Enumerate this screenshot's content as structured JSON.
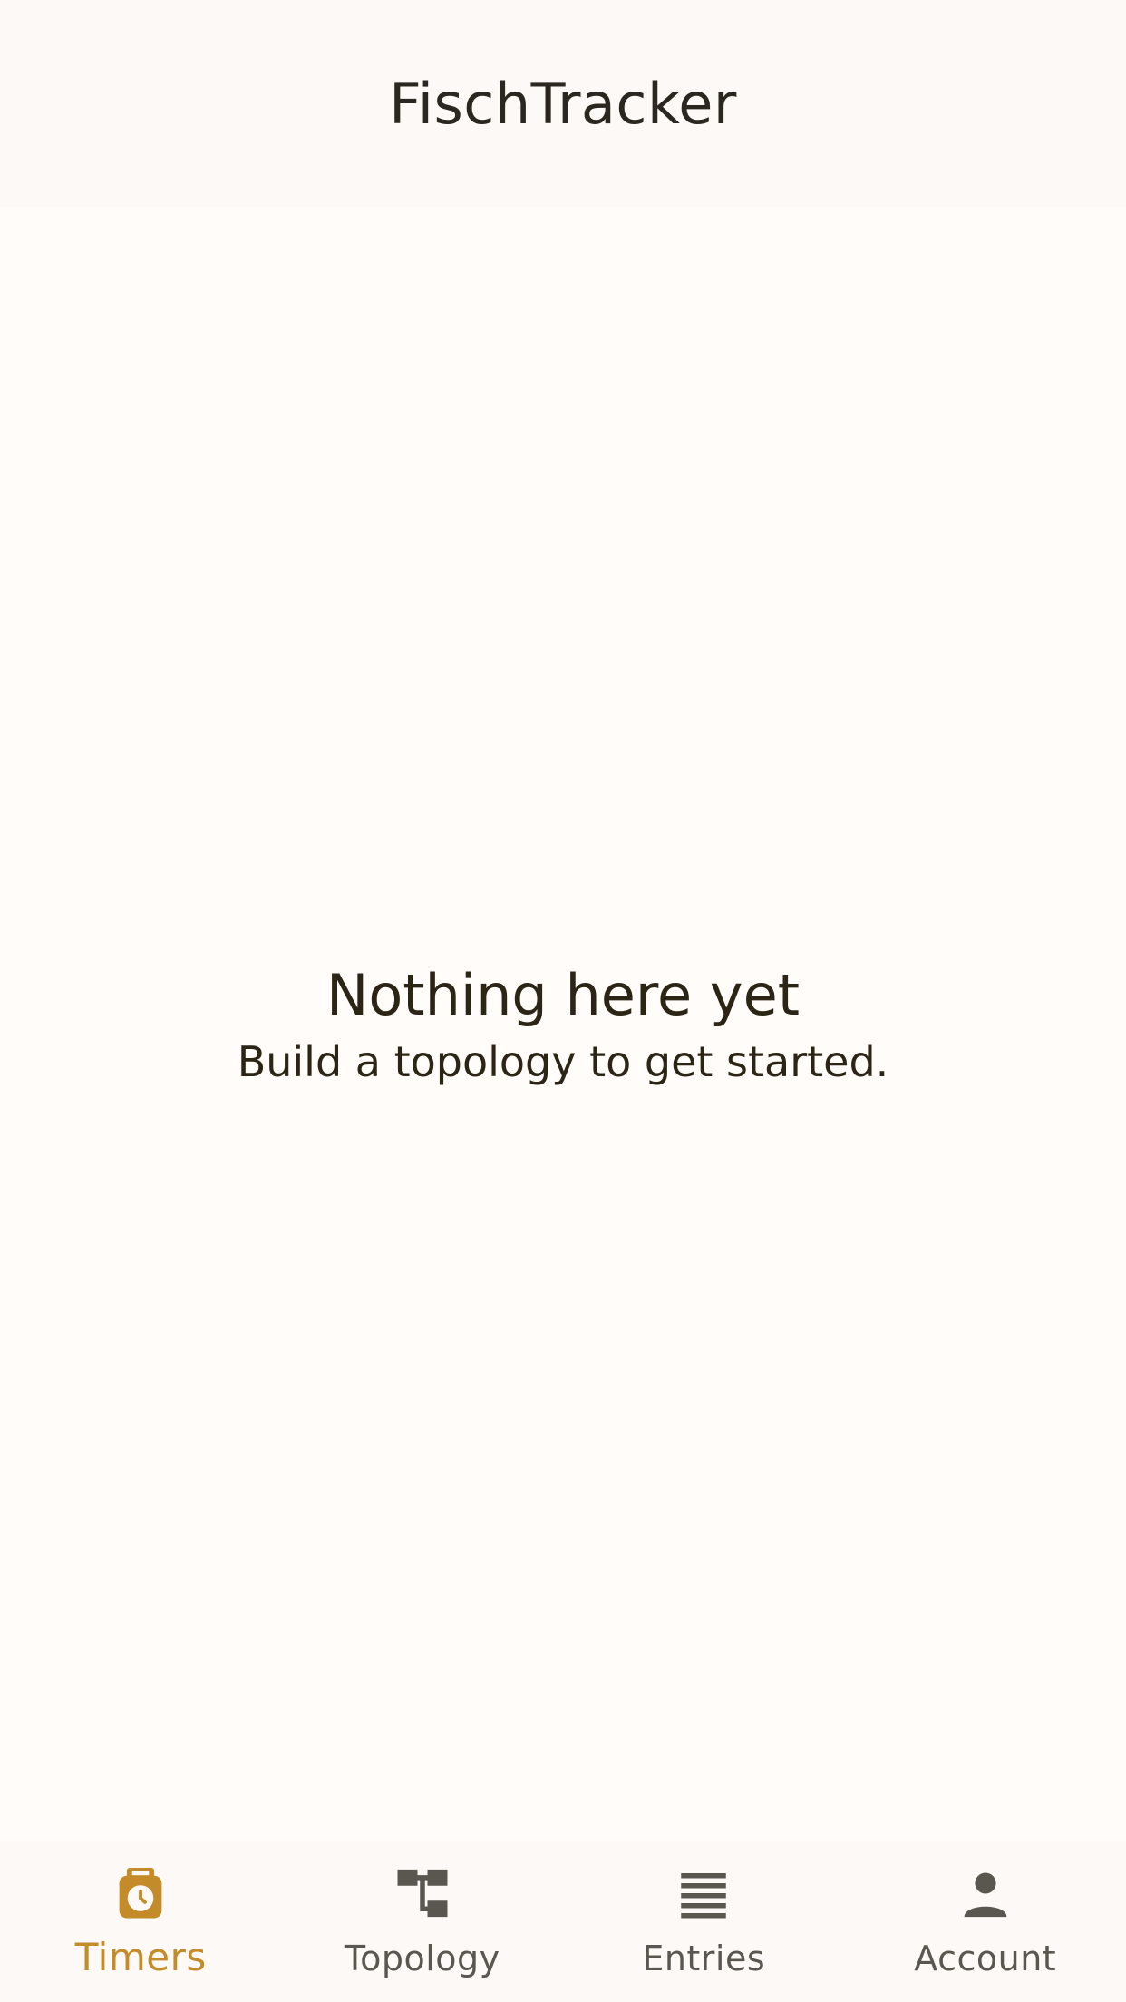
{
  "app": {
    "title": "FischTracker"
  },
  "empty_state": {
    "title": "Nothing here yet",
    "subtitle": "Build a topology to get started."
  },
  "bottom_nav": {
    "active": "timers",
    "accent_color": "#c48b2a",
    "inactive_color": "#5a5650",
    "items": [
      {
        "id": "timers",
        "label": "Timers",
        "icon": "timer-icon"
      },
      {
        "id": "topology",
        "label": "Topology",
        "icon": "topology-icon"
      },
      {
        "id": "entries",
        "label": "Entries",
        "icon": "list-icon"
      },
      {
        "id": "account",
        "label": "Account",
        "icon": "person-icon"
      }
    ]
  }
}
